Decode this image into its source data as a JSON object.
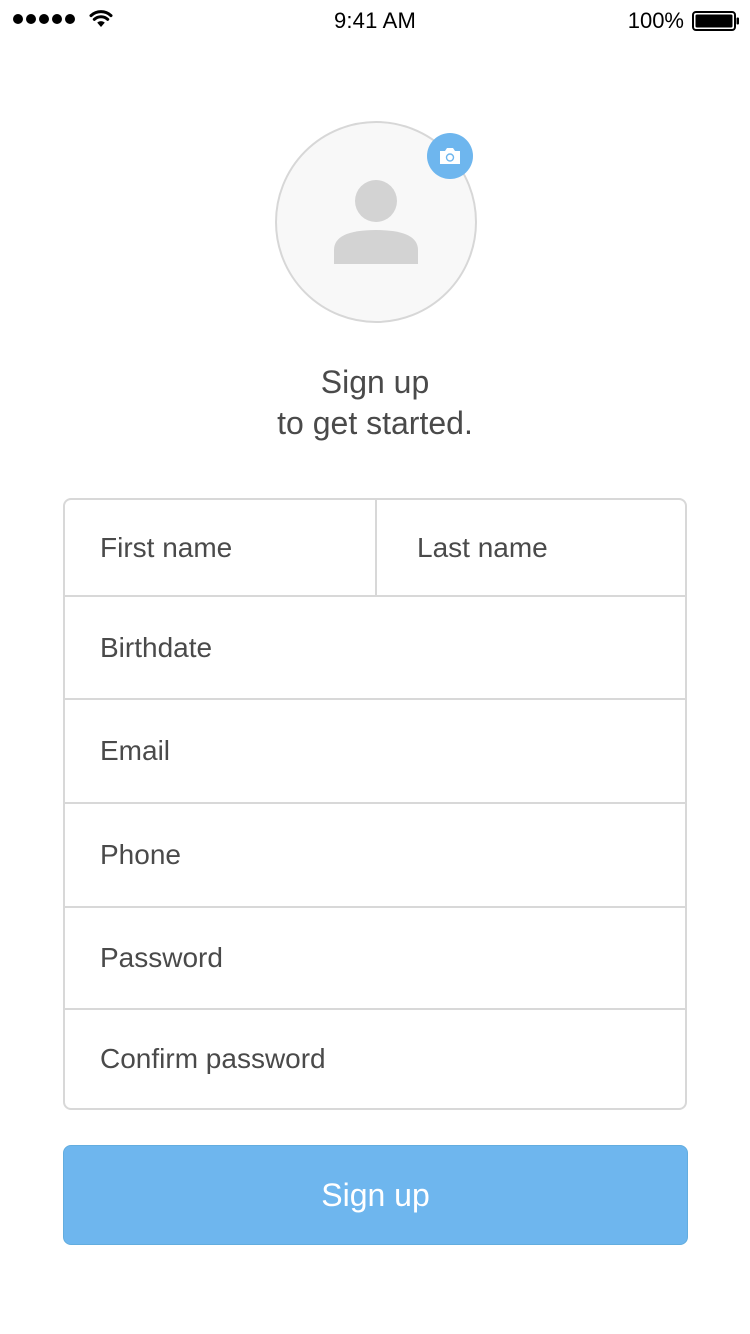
{
  "status_bar": {
    "time": "9:41 AM",
    "battery_percent": "100%",
    "signal_icon": "signal-dots-icon",
    "wifi_icon": "wifi-icon",
    "battery_icon": "battery-full-icon"
  },
  "avatar": {
    "placeholder_icon": "person-icon",
    "edit_icon": "camera-icon",
    "accent_color": "#6eb6ee"
  },
  "heading": {
    "line1": "Sign up",
    "line2": "to get started."
  },
  "form": {
    "first_name_placeholder": "First name",
    "last_name_placeholder": "Last name",
    "birthdate_placeholder": "Birthdate",
    "email_placeholder": "Email",
    "phone_placeholder": "Phone",
    "password_placeholder": "Password",
    "confirm_password_placeholder": "Confirm password"
  },
  "actions": {
    "signup_label": "Sign up",
    "button_color": "#6eb6ee"
  }
}
